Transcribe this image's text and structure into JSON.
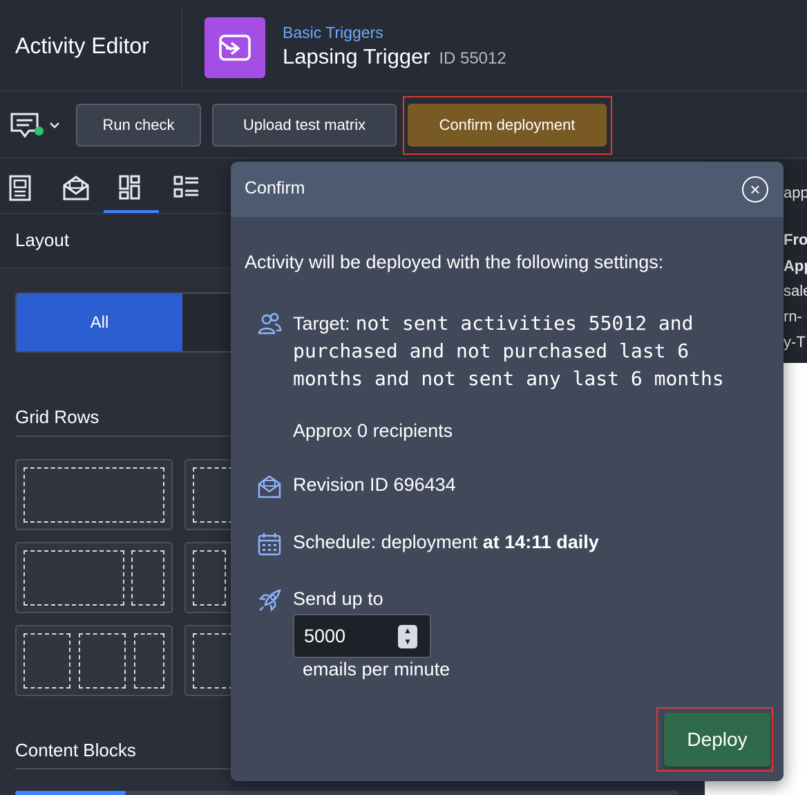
{
  "app": {
    "title": "Activity Editor"
  },
  "activity": {
    "breadcrumb": "Basic Triggers",
    "name": "Lapsing Trigger",
    "id_label": "ID 55012",
    "icon": "email-send-icon",
    "icon_color": "#a54ee6"
  },
  "toolbar": {
    "comments_icon": "comment-icon",
    "run_check": "Run check",
    "upload_matrix": "Upload test matrix",
    "confirm_deployment": "Confirm deployment"
  },
  "tabs": [
    "document-icon",
    "email-open-icon",
    "grid-layout-icon",
    "list-layout-icon"
  ],
  "left_panel": {
    "layout_title": "Layout",
    "filter_all": "All",
    "grid_rows_title": "Grid Rows",
    "content_blocks_title": "Content Blocks"
  },
  "right_panel": {
    "lines": [
      "app",
      "Fron",
      "App",
      "sale",
      "rn-",
      "y-T"
    ]
  },
  "modal": {
    "title": "Confirm",
    "intro": "Activity will be deployed with the following settings:",
    "target_label": "Target:",
    "target_value": "not sent activities 55012 and purchased and not purchased last 6 months and not sent any last 6 months",
    "approx": "Approx 0 recipients",
    "revision": "Revision ID 696434",
    "schedule_prefix": "Schedule: deployment",
    "schedule_time": "at 14:11 daily",
    "send_up_to": "Send up to",
    "rate_value": "5000",
    "per_minute": "emails per minute",
    "deploy": "Deploy"
  },
  "colors": {
    "accent_blue": "#2b5fd1",
    "confirm_button": "#7a5a24",
    "deploy_button": "#2f6b4a",
    "highlight_outline": "#e33a2e",
    "status_online": "#2fc46b"
  }
}
